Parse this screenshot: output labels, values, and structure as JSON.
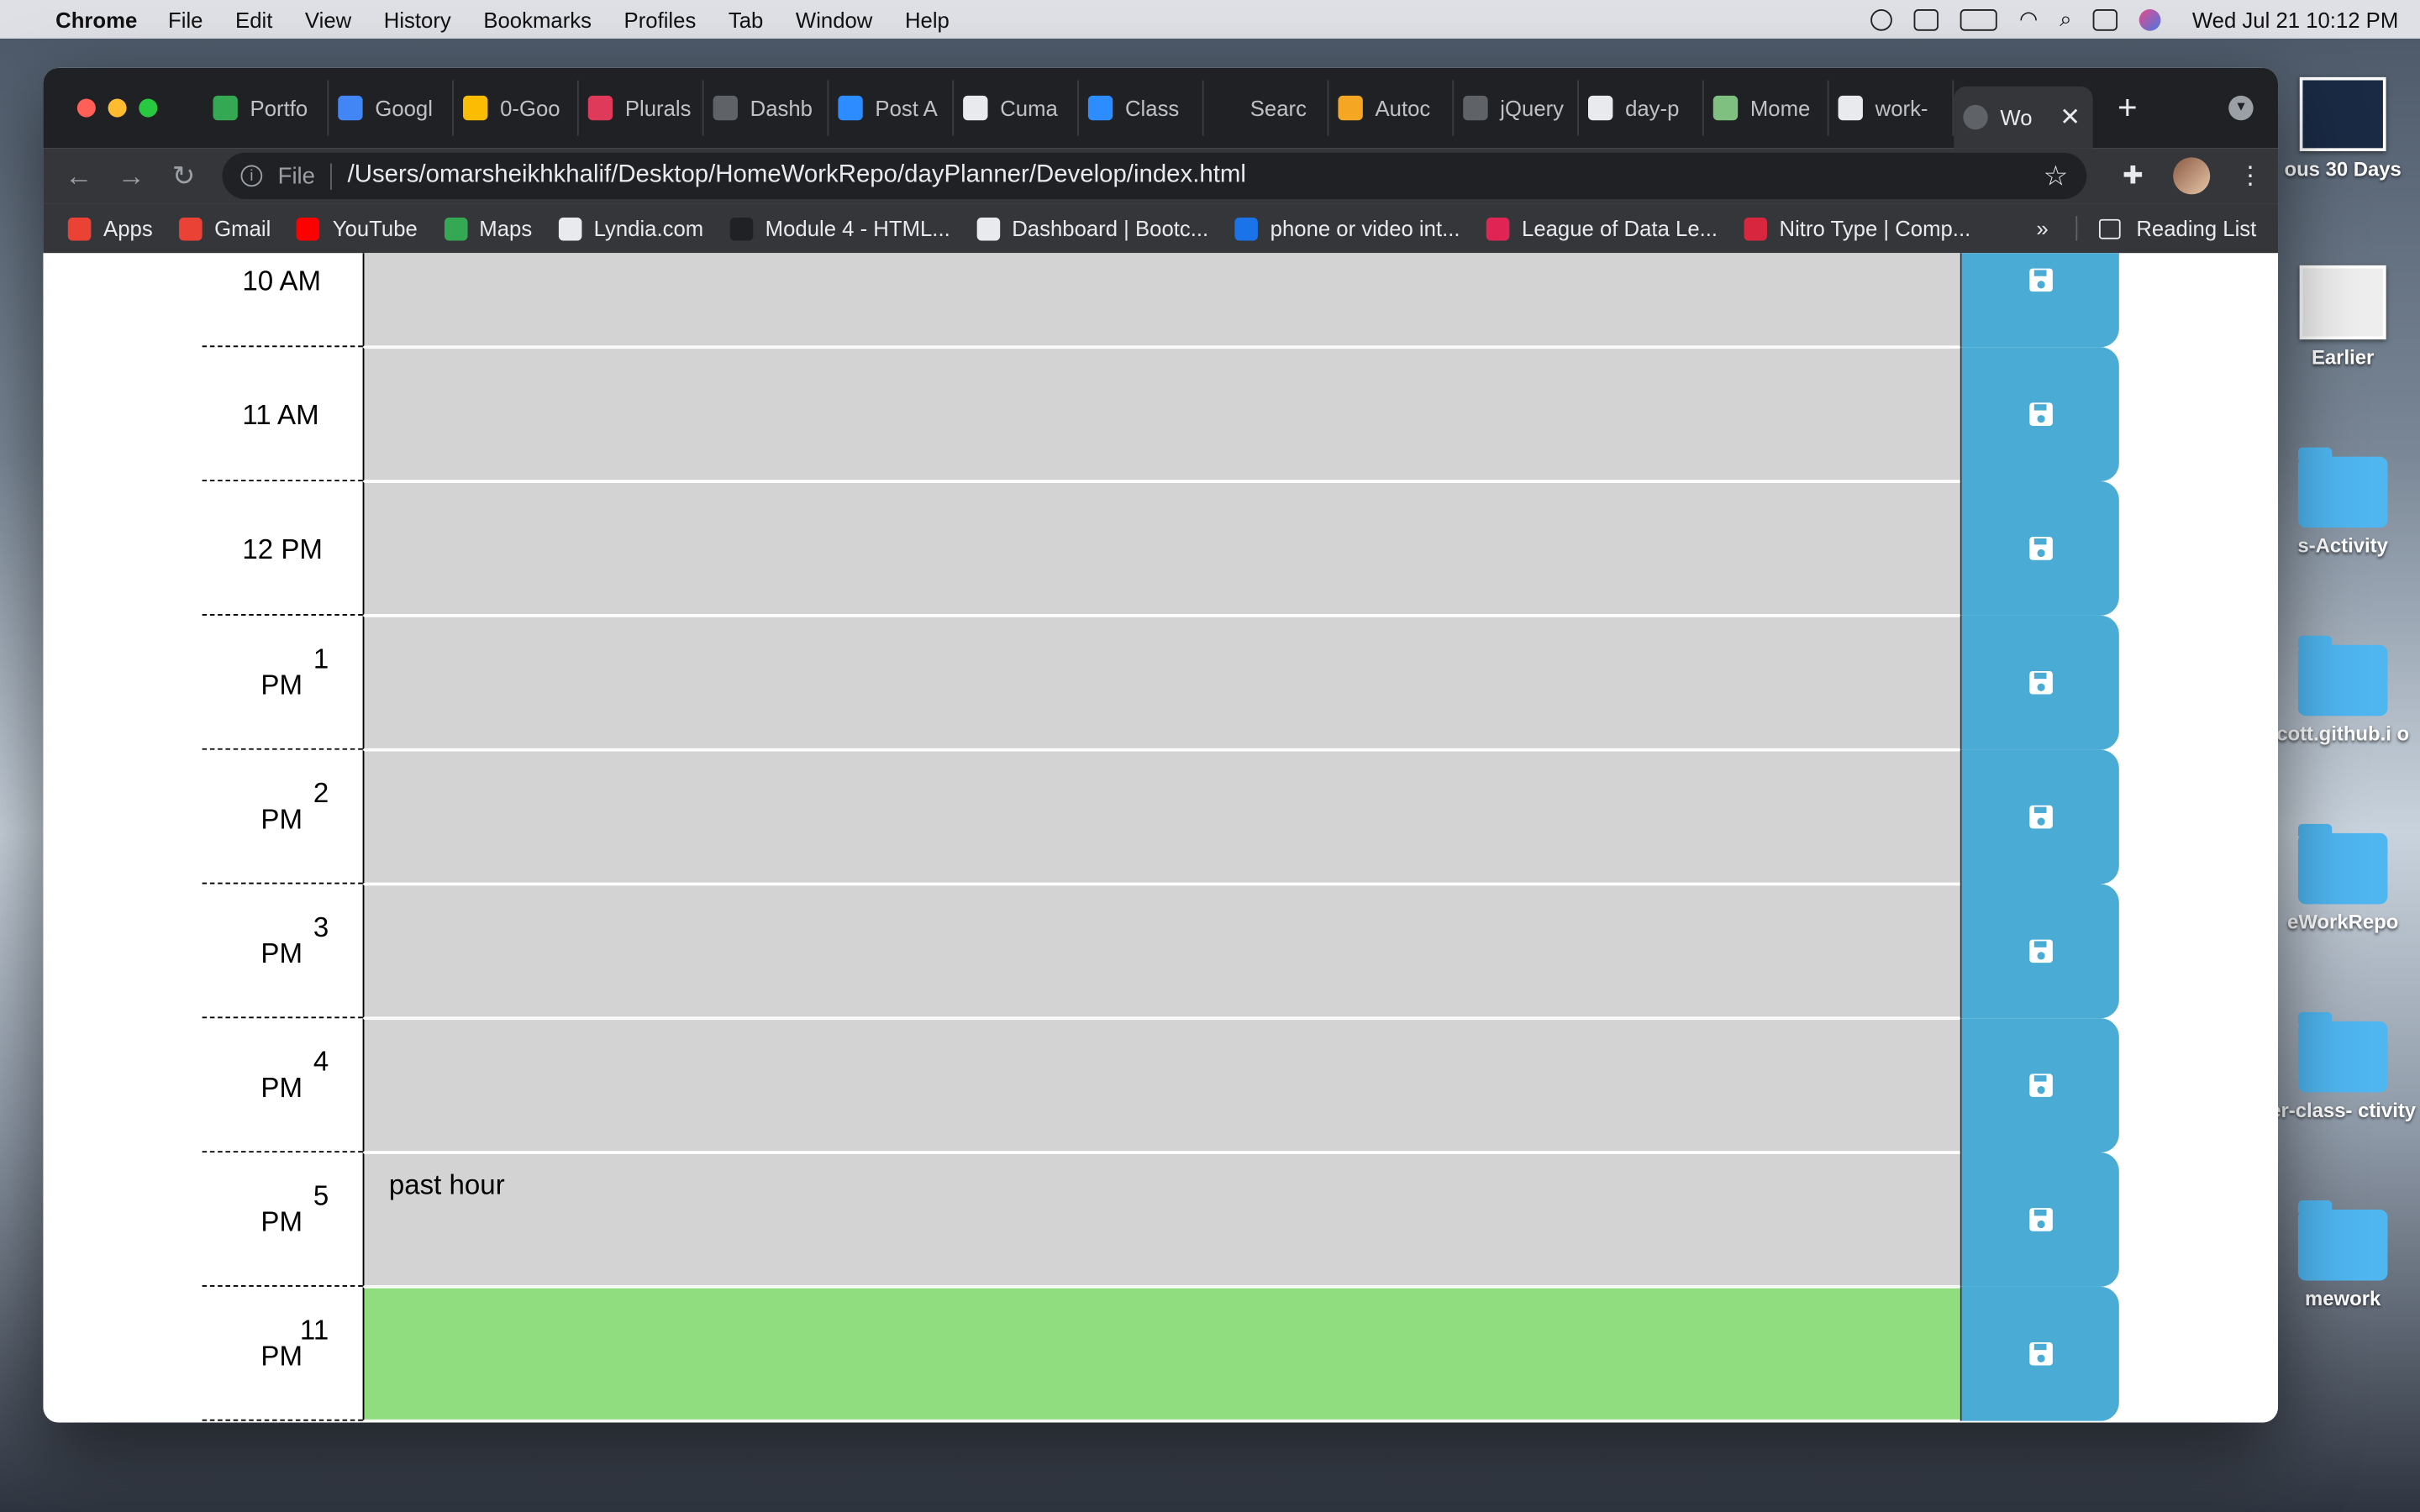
{
  "menubar": {
    "app": "Chrome",
    "menus": [
      "File",
      "Edit",
      "View",
      "History",
      "Bookmarks",
      "Profiles",
      "Tab",
      "Window",
      "Help"
    ],
    "clock": "Wed Jul 21  10:12 PM"
  },
  "desktop": {
    "items": [
      "ous 30 Days",
      "Earlier",
      "s-Activity",
      "cott.github.i o",
      "eWorkRepo",
      "er-class- ctivity",
      "mework"
    ]
  },
  "tabs": [
    {
      "label": "Portfo",
      "color": "#34a853"
    },
    {
      "label": "Googl",
      "color": "#4285f4"
    },
    {
      "label": "0-Goo",
      "color": "#fbbc04"
    },
    {
      "label": "Plurals",
      "color": "#e03a5b"
    },
    {
      "label": "Dashb",
      "color": "#5f6368"
    },
    {
      "label": "Post A",
      "color": "#2d8cff"
    },
    {
      "label": "Cuma",
      "color": "#e8eaed"
    },
    {
      "label": "Class",
      "color": "#2d8cff"
    },
    {
      "label": "Searc",
      "color": "#202124"
    },
    {
      "label": "Autoc",
      "color": "#f5a623"
    },
    {
      "label": "jQuery",
      "color": "#5f6368"
    },
    {
      "label": "day-p",
      "color": "#e8eaed"
    },
    {
      "label": "Mome",
      "color": "#7fbf7f"
    },
    {
      "label": "work-",
      "color": "#e8eaed"
    }
  ],
  "active_tab": {
    "label": "Wo",
    "close": "✕"
  },
  "address": {
    "scheme": "File",
    "url": "/Users/omarsheikhkhalif/Desktop/HomeWorkRepo/dayPlanner/Develop/index.html"
  },
  "bookmarks": [
    {
      "label": "Apps",
      "color": "#ea4335"
    },
    {
      "label": "Gmail",
      "color": "#ea4335"
    },
    {
      "label": "YouTube",
      "color": "#ff0000"
    },
    {
      "label": "Maps",
      "color": "#34a853"
    },
    {
      "label": "Lyndia.com",
      "color": "#e8eaed"
    },
    {
      "label": "Module 4 - HTML...",
      "color": "#202124"
    },
    {
      "label": "Dashboard | Bootc...",
      "color": "#e8eaed"
    },
    {
      "label": "phone or video int...",
      "color": "#1a73e8"
    },
    {
      "label": "League of Data Le...",
      "color": "#e02454"
    },
    {
      "label": "Nitro Type | Comp...",
      "color": "#d7263d"
    }
  ],
  "bookmarks_more": "»",
  "reading_list": "Reading List",
  "planner": {
    "rows": [
      {
        "hour": "10",
        "ampm": "AM",
        "single": "10 AM",
        "text": "",
        "state": "past"
      },
      {
        "hour": "11",
        "ampm": "AM",
        "single": "11 AM",
        "text": "",
        "state": "past"
      },
      {
        "hour": "12",
        "ampm": "PM",
        "single": "12 PM",
        "text": "",
        "state": "past"
      },
      {
        "hour": "1",
        "ampm": "PM",
        "single": "",
        "text": "",
        "state": "past"
      },
      {
        "hour": "2",
        "ampm": "PM",
        "single": "",
        "text": "",
        "state": "past"
      },
      {
        "hour": "3",
        "ampm": "PM",
        "single": "",
        "text": "",
        "state": "past"
      },
      {
        "hour": "4",
        "ampm": "PM",
        "single": "",
        "text": "",
        "state": "past"
      },
      {
        "hour": "5",
        "ampm": "PM",
        "single": "",
        "text": "past hour",
        "state": "past"
      },
      {
        "hour": "11",
        "ampm": "PM",
        "single": "",
        "text": "",
        "state": "present"
      }
    ]
  }
}
